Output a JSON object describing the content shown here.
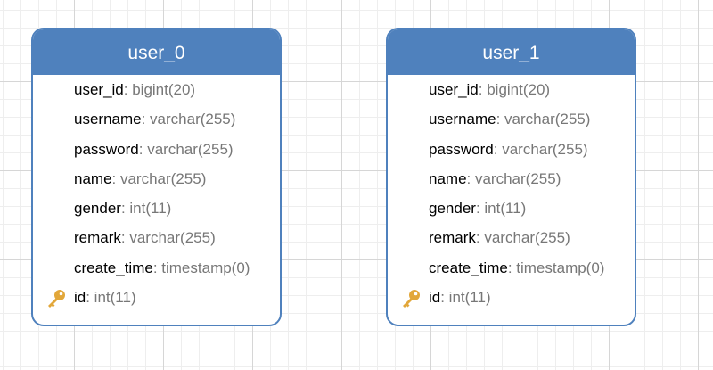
{
  "diagram": {
    "colors": {
      "header_fill": "#4f81bd",
      "header_text": "#ffffff",
      "field_name": "#000000",
      "field_type": "#777777",
      "key_icon": "#e2a73a"
    },
    "entities": [
      {
        "title": "user_0",
        "fields": [
          {
            "name": "user_id",
            "type": ": bigint(20)",
            "primary_key": false
          },
          {
            "name": "username",
            "type": ": varchar(255)",
            "primary_key": false
          },
          {
            "name": "password",
            "type": ": varchar(255)",
            "primary_key": false
          },
          {
            "name": "name",
            "type": ": varchar(255)",
            "primary_key": false
          },
          {
            "name": "gender",
            "type": ": int(11)",
            "primary_key": false
          },
          {
            "name": "remark",
            "type": ": varchar(255)",
            "primary_key": false
          },
          {
            "name": "create_time",
            "type": ": timestamp(0)",
            "primary_key": false
          },
          {
            "name": "id",
            "type": ": int(11)",
            "primary_key": true,
            "icon": "key-icon"
          }
        ]
      },
      {
        "title": "user_1",
        "fields": [
          {
            "name": "user_id",
            "type": ": bigint(20)",
            "primary_key": false
          },
          {
            "name": "username",
            "type": ": varchar(255)",
            "primary_key": false
          },
          {
            "name": "password",
            "type": ": varchar(255)",
            "primary_key": false
          },
          {
            "name": "name",
            "type": ": varchar(255)",
            "primary_key": false
          },
          {
            "name": "gender",
            "type": ": int(11)",
            "primary_key": false
          },
          {
            "name": "remark",
            "type": ": varchar(255)",
            "primary_key": false
          },
          {
            "name": "create_time",
            "type": ": timestamp(0)",
            "primary_key": false
          },
          {
            "name": "id",
            "type": ": int(11)",
            "primary_key": true,
            "icon": "key-icon"
          }
        ]
      }
    ]
  }
}
